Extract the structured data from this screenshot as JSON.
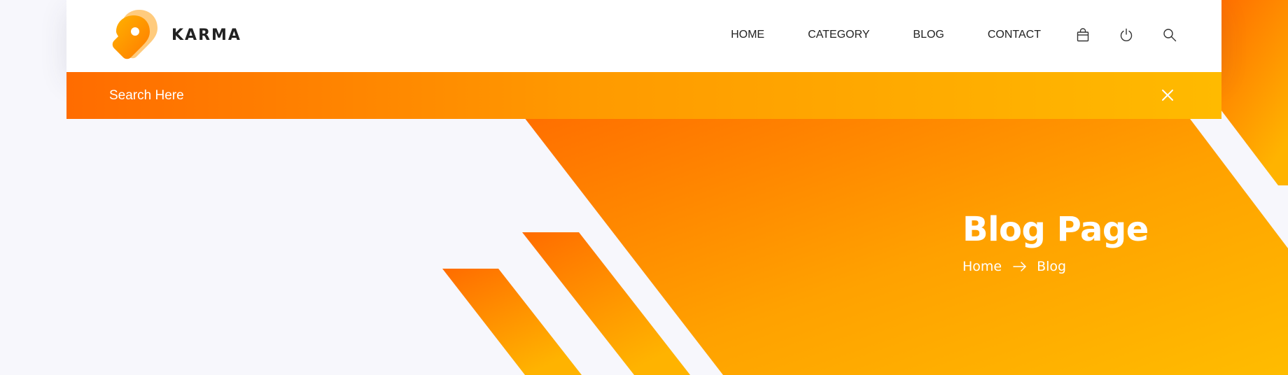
{
  "brand": {
    "name": "KARMA",
    "logo_icon": "location-tag-icon"
  },
  "nav": {
    "items": [
      {
        "label": "HOME"
      },
      {
        "label": "CATEGORY"
      },
      {
        "label": "BLOG"
      },
      {
        "label": "CONTACT"
      }
    ],
    "icons": [
      "shopping-bag-icon",
      "power-icon",
      "search-icon"
    ]
  },
  "search": {
    "placeholder": "Search Here",
    "value": "",
    "close_icon": "close-icon"
  },
  "banner": {
    "title": "Blog Page",
    "breadcrumb": {
      "home": "Home",
      "separator_icon": "arrow-right-icon",
      "current": "Blog"
    }
  },
  "colors": {
    "accent_start": "#ff6c00",
    "accent_end": "#ffba00",
    "page_background": "#f7f7fc",
    "header_background": "#ffffff",
    "text_dark": "#222222"
  }
}
